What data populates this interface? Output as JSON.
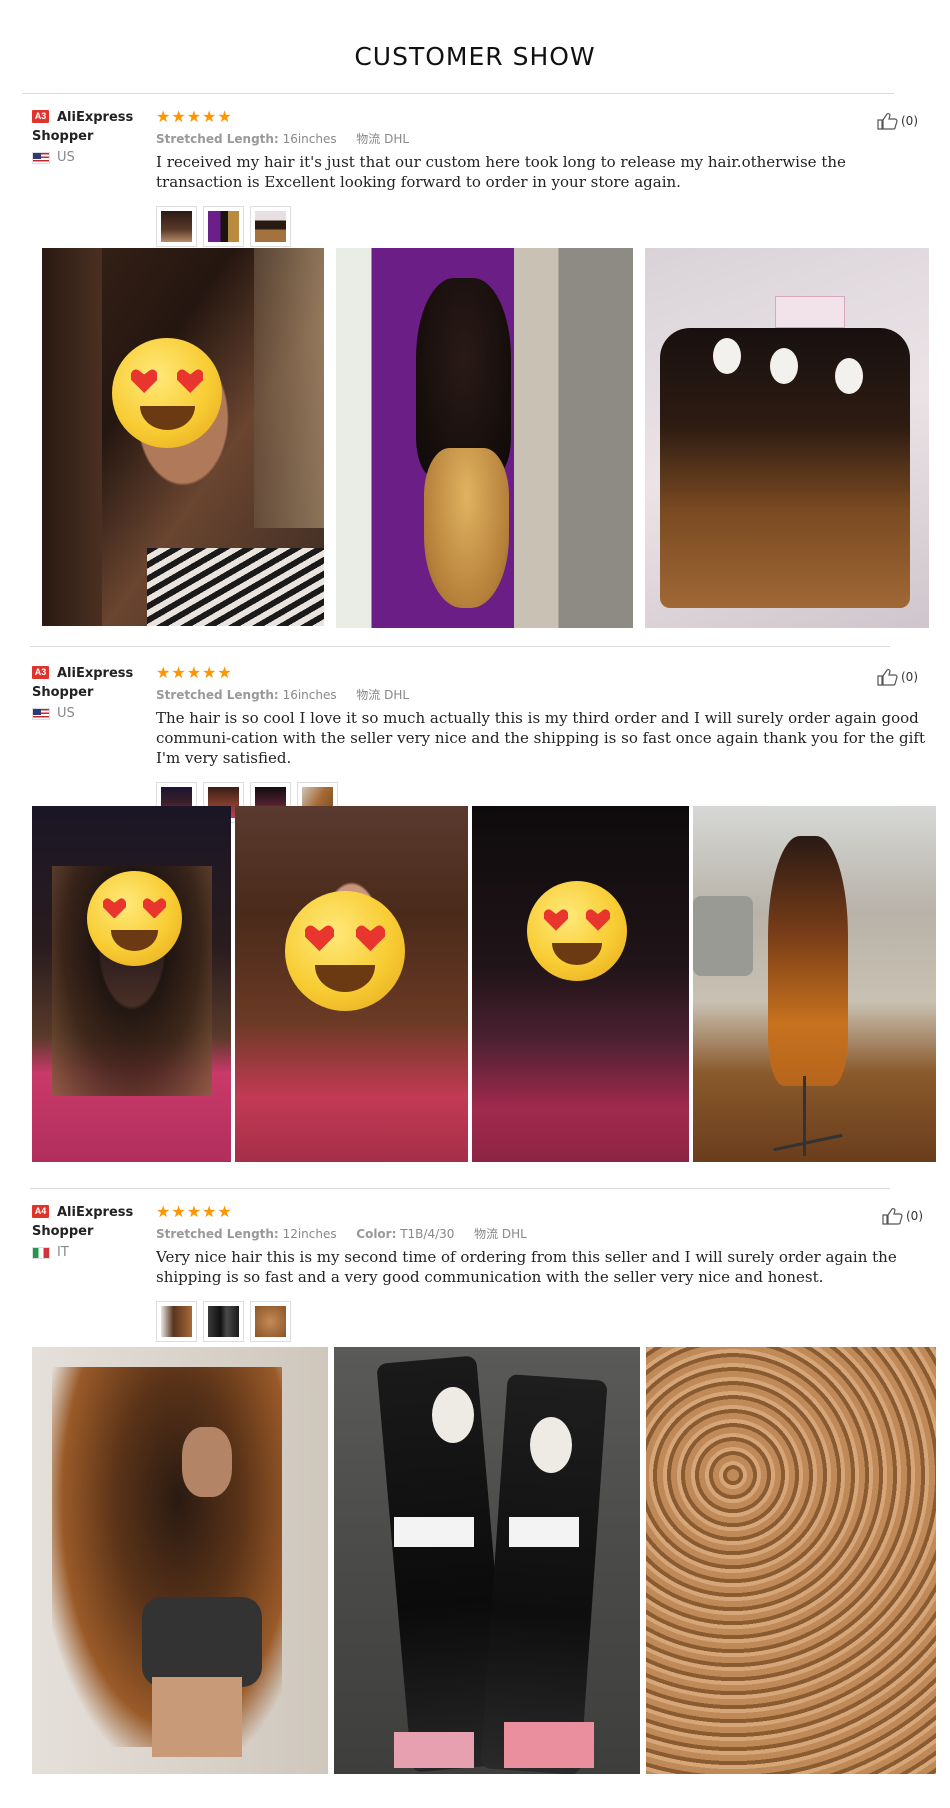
{
  "page_title": "CUSTOMER SHOW",
  "reviews": [
    {
      "badge": "A3",
      "shopper": "AliExpress Shopper",
      "country": "US",
      "stars": "★★★★★",
      "attrs": [
        {
          "key": "Stretched Length:",
          "value": "16inches"
        },
        {
          "key": "物流",
          "value": "DHL"
        }
      ],
      "text": "I received my hair it's just that our custom here took long to release my hair.otherwise the transaction is Excellent looking forward to order in your store again.",
      "helpful": "(0)",
      "thumb_count": 3
    },
    {
      "badge": "A3",
      "shopper": "AliExpress Shopper",
      "country": "US",
      "stars": "★★★★★",
      "attrs": [
        {
          "key": "Stretched Length:",
          "value": "16inches"
        },
        {
          "key": "物流",
          "value": "DHL"
        }
      ],
      "text": "The hair is so cool I love it so much actually this is my third order and I will surely order again good communi-cation with the seller very nice and the shipping is so fast once again thank you for the gift I'm very satisfied.",
      "helpful": "(0)",
      "thumb_count": 4
    },
    {
      "badge": "A4",
      "shopper": "AliExpress Shopper",
      "country": "IT",
      "stars": "★★★★★",
      "attrs": [
        {
          "key": "Stretched Length:",
          "value": "12inches"
        },
        {
          "key": "Color:",
          "value": "T1B/4/30"
        },
        {
          "key": "物流",
          "value": "DHL"
        }
      ],
      "text": "Very nice hair this is my second time of ordering from this seller and I will surely order again the shipping is so fast and a very good communication with the seller very nice and honest.",
      "helpful": "(0)",
      "thumb_count": 3
    }
  ],
  "colors": {
    "star": "#ff9500",
    "badge": "#e0332b"
  },
  "icons": [
    "thumbs-up-icon",
    "flag-us-icon",
    "flag-it-icon",
    "heart-eyes-emoji"
  ]
}
